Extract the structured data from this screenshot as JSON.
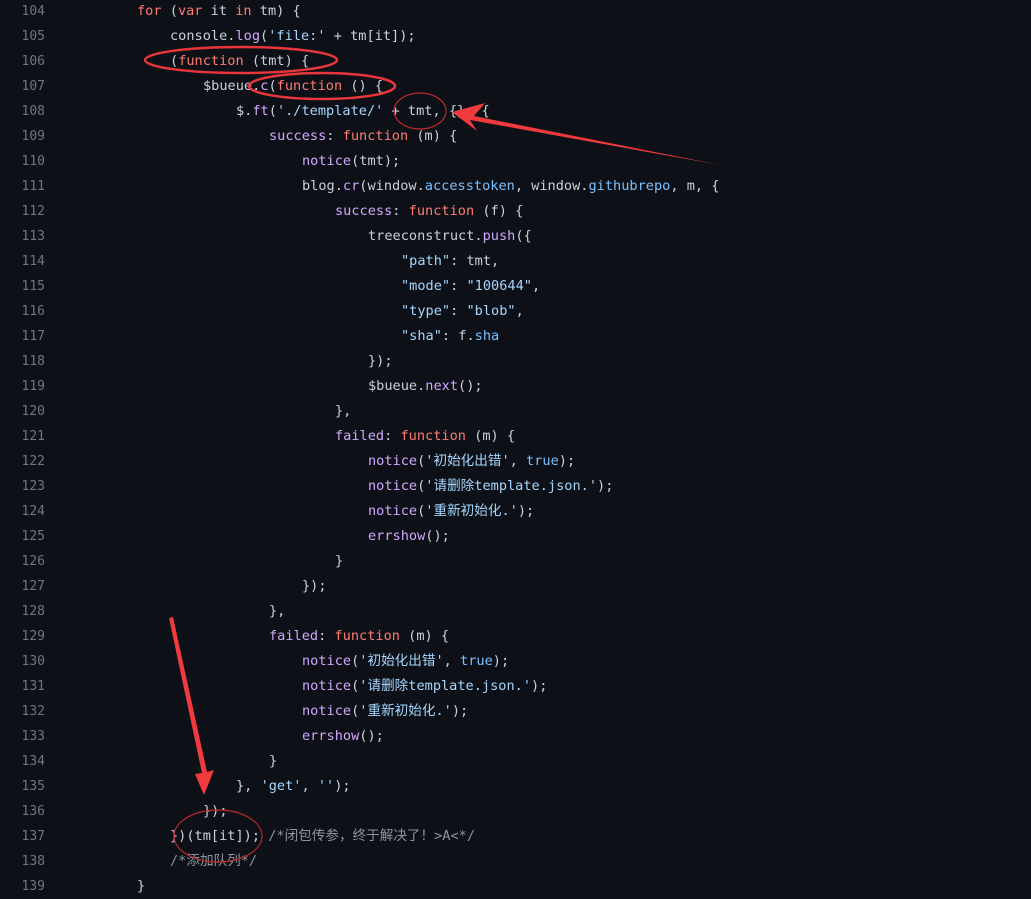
{
  "editor": {
    "theme": "dark",
    "colors": {
      "background": "#0d1117",
      "line_number": "#6e7681",
      "text": "#c9d1d9",
      "keyword": "#ff7b72",
      "function": "#d2a8ff",
      "string": "#a5d6ff",
      "property": "#79c0ff",
      "comment": "#8b949e",
      "annotation": "#e8363a"
    },
    "lines": [
      {
        "n": "104",
        "indent": 0,
        "tokens": [
          [
            "k",
            "for"
          ],
          [
            "t",
            " ("
          ],
          [
            "k",
            "var"
          ],
          [
            "t",
            " it "
          ],
          [
            "k",
            "in"
          ],
          [
            "t",
            " tm) {"
          ]
        ]
      },
      {
        "n": "105",
        "indent": 1,
        "tokens": [
          [
            "t",
            "console."
          ],
          [
            "f",
            "log"
          ],
          [
            "t",
            "("
          ],
          [
            "s",
            "'file:'"
          ],
          [
            "t",
            " + tm[it]);"
          ]
        ]
      },
      {
        "n": "106",
        "indent": 1,
        "tokens": [
          [
            "t",
            "("
          ],
          [
            "k",
            "function"
          ],
          [
            "t",
            " (tmt) {"
          ]
        ]
      },
      {
        "n": "107",
        "indent": 2,
        "tokens": [
          [
            "t",
            "$bueue."
          ],
          [
            "f",
            "c"
          ],
          [
            "t",
            "("
          ],
          [
            "k",
            "function"
          ],
          [
            "t",
            " () {"
          ]
        ]
      },
      {
        "n": "108",
        "indent": 3,
        "tokens": [
          [
            "t",
            "$."
          ],
          [
            "f",
            "ft"
          ],
          [
            "t",
            "("
          ],
          [
            "s",
            "'./template/'"
          ],
          [
            "t",
            " + tmt, {}, {"
          ]
        ]
      },
      {
        "n": "109",
        "indent": 4,
        "tokens": [
          [
            "f",
            "success"
          ],
          [
            "t",
            ": "
          ],
          [
            "k",
            "function"
          ],
          [
            "t",
            " (m) {"
          ]
        ]
      },
      {
        "n": "110",
        "indent": 5,
        "tokens": [
          [
            "f",
            "notice"
          ],
          [
            "t",
            "(tmt);"
          ]
        ]
      },
      {
        "n": "111",
        "indent": 5,
        "tokens": [
          [
            "t",
            "blog."
          ],
          [
            "f",
            "cr"
          ],
          [
            "t",
            "(window."
          ],
          [
            "p",
            "accesstoken"
          ],
          [
            "t",
            ", window."
          ],
          [
            "p",
            "githubrepo"
          ],
          [
            "t",
            ", m, {"
          ]
        ]
      },
      {
        "n": "112",
        "indent": 6,
        "tokens": [
          [
            "f",
            "success"
          ],
          [
            "t",
            ": "
          ],
          [
            "k",
            "function"
          ],
          [
            "t",
            " (f) {"
          ]
        ]
      },
      {
        "n": "113",
        "indent": 7,
        "tokens": [
          [
            "t",
            "treeconstruct."
          ],
          [
            "f",
            "push"
          ],
          [
            "t",
            "({"
          ]
        ]
      },
      {
        "n": "114",
        "indent": 8,
        "tokens": [
          [
            "s",
            "\"path\""
          ],
          [
            "t",
            ": tmt,"
          ]
        ]
      },
      {
        "n": "115",
        "indent": 8,
        "tokens": [
          [
            "s",
            "\"mode\""
          ],
          [
            "t",
            ": "
          ],
          [
            "s",
            "\"100644\""
          ],
          [
            "t",
            ","
          ]
        ]
      },
      {
        "n": "116",
        "indent": 8,
        "tokens": [
          [
            "s",
            "\"type\""
          ],
          [
            "t",
            ": "
          ],
          [
            "s",
            "\"blob\""
          ],
          [
            "t",
            ","
          ]
        ]
      },
      {
        "n": "117",
        "indent": 8,
        "tokens": [
          [
            "s",
            "\"sha\""
          ],
          [
            "t",
            ": f."
          ],
          [
            "p",
            "sha"
          ]
        ]
      },
      {
        "n": "118",
        "indent": 7,
        "tokens": [
          [
            "t",
            "});"
          ]
        ]
      },
      {
        "n": "119",
        "indent": 7,
        "tokens": [
          [
            "t",
            "$bueue."
          ],
          [
            "f",
            "next"
          ],
          [
            "t",
            "();"
          ]
        ]
      },
      {
        "n": "120",
        "indent": 6,
        "tokens": [
          [
            "t",
            "},"
          ]
        ]
      },
      {
        "n": "121",
        "indent": 6,
        "tokens": [
          [
            "f",
            "failed"
          ],
          [
            "t",
            ": "
          ],
          [
            "k",
            "function"
          ],
          [
            "t",
            " (m) {"
          ]
        ]
      },
      {
        "n": "122",
        "indent": 7,
        "tokens": [
          [
            "f",
            "notice"
          ],
          [
            "t",
            "("
          ],
          [
            "s",
            "'初始化出错'"
          ],
          [
            "t",
            ", "
          ],
          [
            "p",
            "true"
          ],
          [
            "t",
            ");"
          ]
        ]
      },
      {
        "n": "123",
        "indent": 7,
        "tokens": [
          [
            "f",
            "notice"
          ],
          [
            "t",
            "("
          ],
          [
            "s",
            "'请删除template.json.'"
          ],
          [
            "t",
            ");"
          ]
        ]
      },
      {
        "n": "124",
        "indent": 7,
        "tokens": [
          [
            "f",
            "notice"
          ],
          [
            "t",
            "("
          ],
          [
            "s",
            "'重新初始化.'"
          ],
          [
            "t",
            ");"
          ]
        ]
      },
      {
        "n": "125",
        "indent": 7,
        "tokens": [
          [
            "f",
            "errshow"
          ],
          [
            "t",
            "();"
          ]
        ]
      },
      {
        "n": "126",
        "indent": 6,
        "tokens": [
          [
            "t",
            "}"
          ]
        ]
      },
      {
        "n": "127",
        "indent": 5,
        "tokens": [
          [
            "t",
            "});"
          ]
        ]
      },
      {
        "n": "128",
        "indent": 4,
        "tokens": [
          [
            "t",
            "},"
          ]
        ]
      },
      {
        "n": "129",
        "indent": 4,
        "tokens": [
          [
            "f",
            "failed"
          ],
          [
            "t",
            ": "
          ],
          [
            "k",
            "function"
          ],
          [
            "t",
            " (m) {"
          ]
        ]
      },
      {
        "n": "130",
        "indent": 5,
        "tokens": [
          [
            "f",
            "notice"
          ],
          [
            "t",
            "("
          ],
          [
            "s",
            "'初始化出错'"
          ],
          [
            "t",
            ", "
          ],
          [
            "p",
            "true"
          ],
          [
            "t",
            ");"
          ]
        ]
      },
      {
        "n": "131",
        "indent": 5,
        "tokens": [
          [
            "f",
            "notice"
          ],
          [
            "t",
            "("
          ],
          [
            "s",
            "'请删除template.json.'"
          ],
          [
            "t",
            ");"
          ]
        ]
      },
      {
        "n": "132",
        "indent": 5,
        "tokens": [
          [
            "f",
            "notice"
          ],
          [
            "t",
            "("
          ],
          [
            "s",
            "'重新初始化.'"
          ],
          [
            "t",
            ");"
          ]
        ]
      },
      {
        "n": "133",
        "indent": 5,
        "tokens": [
          [
            "f",
            "errshow"
          ],
          [
            "t",
            "();"
          ]
        ]
      },
      {
        "n": "134",
        "indent": 4,
        "tokens": [
          [
            "t",
            "}"
          ]
        ]
      },
      {
        "n": "135",
        "indent": 3,
        "tokens": [
          [
            "t",
            "}, "
          ],
          [
            "s",
            "'get'"
          ],
          [
            "t",
            ", "
          ],
          [
            "s",
            "''"
          ],
          [
            "t",
            ");"
          ]
        ]
      },
      {
        "n": "136",
        "indent": 2,
        "tokens": [
          [
            "t",
            "});"
          ]
        ]
      },
      {
        "n": "137",
        "indent": 1,
        "tokens": [
          [
            "t",
            "})(tm[it]); "
          ],
          [
            "c",
            "/*闭包传参，终于解决了！>A<*/"
          ]
        ]
      },
      {
        "n": "138",
        "indent": 1,
        "tokens": [
          [
            "c",
            "/*添加队列*/"
          ]
        ]
      },
      {
        "n": "139",
        "indent": 0,
        "tokens": [
          [
            "t",
            "}"
          ]
        ]
      }
    ]
  },
  "annotations": [
    {
      "type": "ellipse",
      "label": "circle-function-tmt",
      "target_line": "106"
    },
    {
      "type": "ellipse",
      "label": "circle-c-function",
      "target_line": "107"
    },
    {
      "type": "ellipse",
      "label": "circle-tmt-arg",
      "target_line": "108"
    },
    {
      "type": "arrow",
      "label": "arrow-to-tmt",
      "target_line": "108"
    },
    {
      "type": "arrow",
      "label": "arrow-to-invocation",
      "target_line": "136"
    },
    {
      "type": "ellipse",
      "label": "circle-tm-it-invocation",
      "target_line": "137"
    }
  ]
}
